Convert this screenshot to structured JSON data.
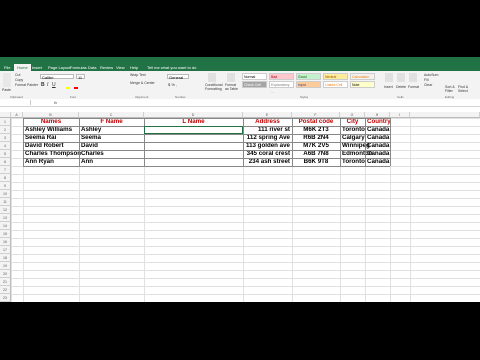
{
  "ribbon": {
    "tabs": [
      "File",
      "Home",
      "Insert",
      "Page Layout",
      "Formulas",
      "Data",
      "Review",
      "View",
      "Help"
    ],
    "tell_me": "Tell me what you want to do",
    "font_name": "Calibri",
    "font_size": "11",
    "number_format": "General",
    "wrap_text": "Wrap Text",
    "merge_center": "Merge & Center",
    "cut": "Cut",
    "copy": "Copy",
    "format_painter": "Format Painter",
    "paste": "Paste",
    "conditional_formatting": "Conditional Formatting",
    "format_as_table": "Format as Table",
    "styles": [
      {
        "label": "Normal",
        "bg": "#ffffff",
        "fg": "#000000"
      },
      {
        "label": "Bad",
        "bg": "#ffc7ce",
        "fg": "#9c0006"
      },
      {
        "label": "Good",
        "bg": "#c6efce",
        "fg": "#006100"
      },
      {
        "label": "Neutral",
        "bg": "#ffeb9c",
        "fg": "#9c5700"
      },
      {
        "label": "Calculation",
        "bg": "#f2f2f2",
        "fg": "#fa7d00"
      },
      {
        "label": "Check Cell",
        "bg": "#a5a5a5",
        "fg": "#ffffff"
      },
      {
        "label": "Explanatory ...",
        "bg": "#ffffff",
        "fg": "#7f7f7f"
      },
      {
        "label": "Input",
        "bg": "#ffcc99",
        "fg": "#3f3f76"
      },
      {
        "label": "Linked Cell",
        "bg": "#ffffff",
        "fg": "#fa7d00"
      },
      {
        "label": "Note",
        "bg": "#ffffcc",
        "fg": "#000000"
      }
    ],
    "insert": "Insert",
    "delete": "Delete",
    "format": "Format",
    "autosum": "AutoSum",
    "fill": "Fill",
    "clear": "Clear",
    "sort_filter": "Sort & Filter",
    "find_select": "Find & Select",
    "group_labels": [
      "Clipboard",
      "Font",
      "Alignment",
      "Number",
      "Styles",
      "Cells",
      "Editing"
    ]
  },
  "formula_bar": {
    "fx": "fx"
  },
  "columns": [
    "A",
    "B",
    "C",
    "D",
    "E",
    "F",
    "G",
    "H",
    "I"
  ],
  "rows": [
    "1",
    "2",
    "3",
    "4",
    "5",
    "6",
    "7",
    "8",
    "9",
    "10",
    "11",
    "12",
    "13",
    "14",
    "15",
    "16",
    "17",
    "18",
    "19",
    "20",
    "21",
    "22",
    "23"
  ],
  "table": {
    "headers": [
      "Names",
      "F Name",
      "L Name",
      "Address",
      "Postal code",
      "City",
      "Country"
    ],
    "rows": [
      [
        "Ashley Williams",
        "Ashley",
        "",
        "111 river st",
        "M6K 2T3",
        "Toronto",
        "Canada"
      ],
      [
        "Seema Rai",
        "Seema",
        "",
        "112 spring Ave",
        "R6B 2N4",
        "Calgary",
        "Canada"
      ],
      [
        "David Robert",
        "David",
        "",
        "113 golden ave",
        "M7K 2V5",
        "Winnipeg",
        "Canada"
      ],
      [
        "Charles Thompson",
        "Charles",
        "",
        "345 coral crest",
        "A6B 7N8",
        "Edmonton",
        "Canada"
      ],
      [
        "Ann Ryan",
        "Ann",
        "",
        "234 ash street",
        "B6K 9T8",
        "Toronto",
        "Canada"
      ]
    ]
  },
  "colors": {
    "excel_green": "#217346",
    "header_red": "#c00000"
  }
}
